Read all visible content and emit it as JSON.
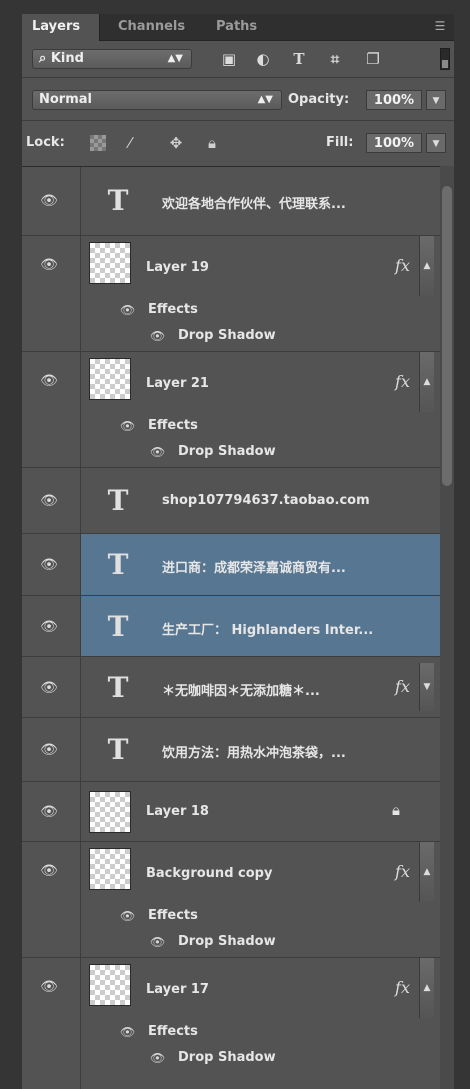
{
  "tabs": [
    {
      "label": "Layers"
    },
    {
      "label": "Channels"
    },
    {
      "label": "Paths"
    }
  ],
  "filter": {
    "kind_label": "Kind",
    "icons": [
      "image-filter-icon",
      "adjustment-filter-icon",
      "type-filter-icon",
      "shape-filter-icon",
      "smart-object-filter-icon"
    ]
  },
  "blend": {
    "mode": "Normal",
    "opacity_label": "Opacity:",
    "opacity_value": "100%"
  },
  "lock": {
    "label": "Lock:",
    "fill_label": "Fill:",
    "fill_value": "100%"
  },
  "layers": [
    {
      "type": "text",
      "name": "欢迎各地合作伙伴、代理联系..."
    },
    {
      "type": "image",
      "name": "Layer 19",
      "fx": "fx",
      "effects_label": "Effects",
      "effect": "Drop Shadow"
    },
    {
      "type": "image",
      "name": "Layer 21",
      "fx": "fx",
      "effects_label": "Effects",
      "effect": "Drop Shadow"
    },
    {
      "type": "text",
      "name": "shop107794637.taobao.com"
    },
    {
      "type": "text",
      "name": "进口商：成都荣泽嘉诚商贸有...",
      "selected": true
    },
    {
      "type": "text",
      "name": "生产工厂： Highlanders Inter...",
      "selected": true
    },
    {
      "type": "text",
      "name": "＊无咖啡因＊无添加糖＊...",
      "fx": "fx"
    },
    {
      "type": "text",
      "name": "饮用方法：用热水冲泡茶袋，..."
    },
    {
      "type": "image",
      "name": "Layer 18",
      "locked": true
    },
    {
      "type": "image",
      "name": "Background copy",
      "fx": "fx",
      "effects_label": "Effects",
      "effect": "Drop Shadow"
    },
    {
      "type": "image",
      "name": "Layer 17",
      "fx": "fx",
      "effects_label": "Effects",
      "effect": "Drop Shadow"
    }
  ]
}
